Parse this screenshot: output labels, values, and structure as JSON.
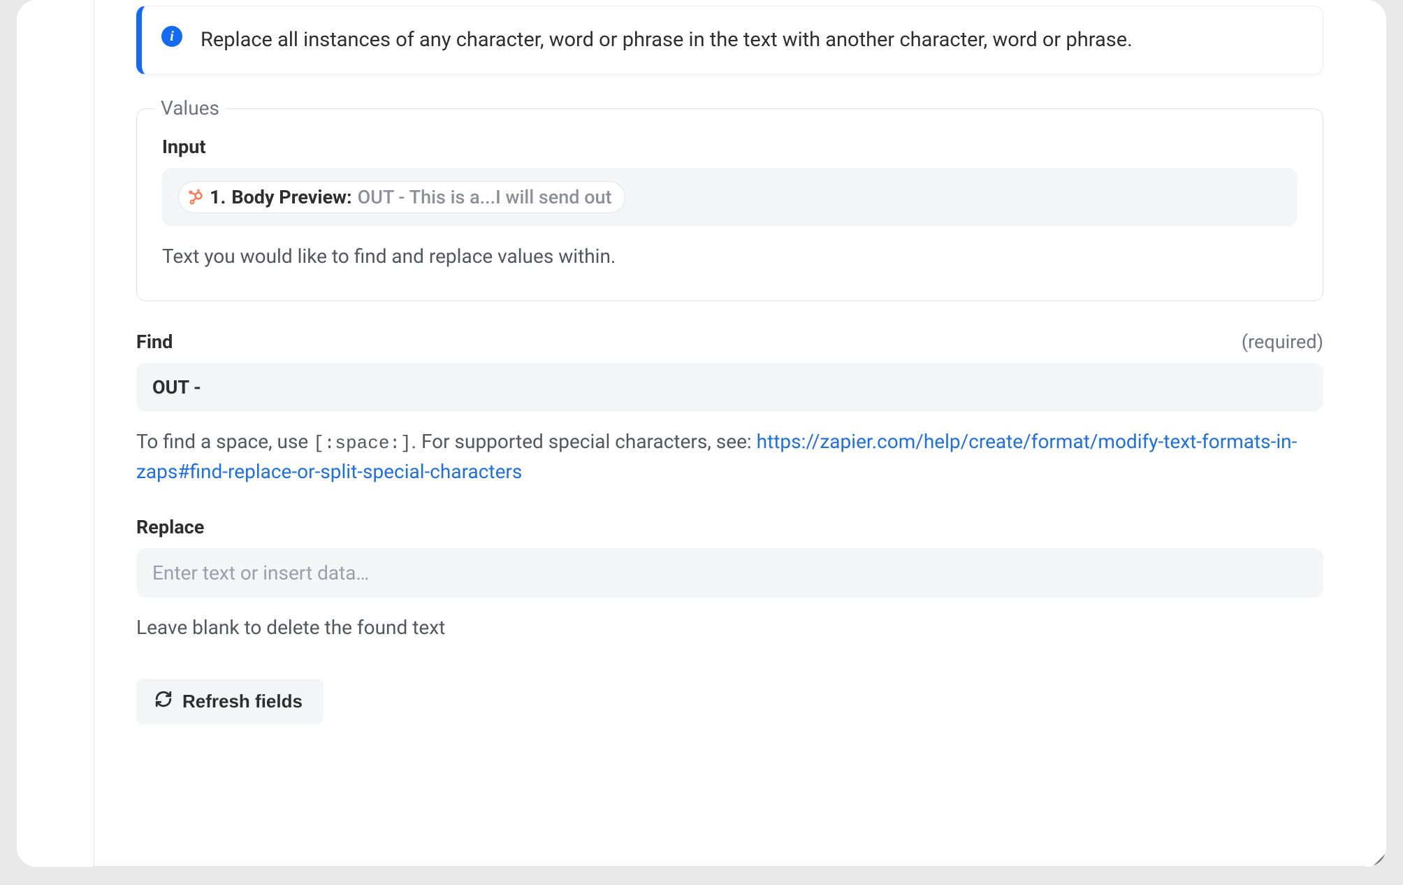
{
  "info": {
    "text": "Replace all instances of any character, word or phrase in the text with another character, word or phrase."
  },
  "values": {
    "legend": "Values",
    "input_label": "Input",
    "pill": {
      "step": "1.",
      "field_name": "Body Preview:",
      "sample": "OUT - This is a...I will send out"
    },
    "helper": "Text you would like to find and replace values within."
  },
  "find": {
    "label": "Find",
    "required_label": "(required)",
    "value": "OUT - ",
    "helper_prefix": "To find a space, use ",
    "helper_code": "[:space:]",
    "helper_mid": ". For supported special characters, see: ",
    "helper_link": "https://zapier.com/help/create/format/modify-text-formats-in-zaps#find-replace-or-split-special-characters"
  },
  "replace": {
    "label": "Replace",
    "placeholder": "Enter text or insert data…",
    "helper": "Leave blank to delete the found text"
  },
  "actions": {
    "refresh": "Refresh fields"
  }
}
